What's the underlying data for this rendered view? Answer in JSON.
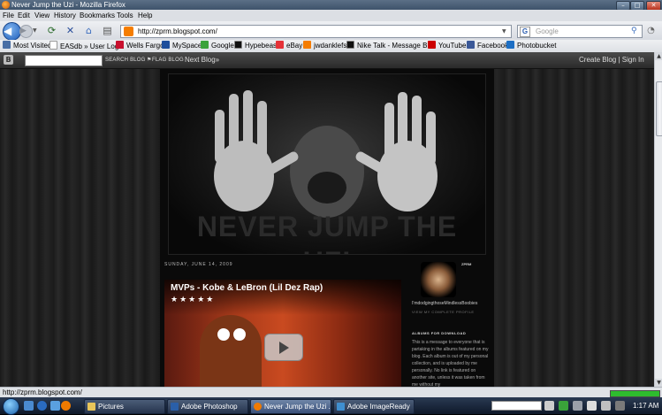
{
  "window": {
    "title": "Never Jump the Uzi - Mozilla Firefox",
    "min": "–",
    "max": "□",
    "close": "✕"
  },
  "menu": [
    "File",
    "Edit",
    "View",
    "History",
    "Bookmarks",
    "Tools",
    "Help"
  ],
  "nav": {
    "url": "http://zprm.blogspot.com/",
    "search_placeholder": "Google"
  },
  "bookmarks": [
    {
      "label": "Most Visited",
      "color": "#4a6fa5"
    },
    {
      "label": "EASdb » User Login",
      "color": "#ffffff"
    },
    {
      "label": "Wells Fargo",
      "color": "#c8102e"
    },
    {
      "label": "MySpace",
      "color": "#1d4e9c"
    },
    {
      "label": "Google",
      "color": "#3aa33a"
    },
    {
      "label": "Hypebeast",
      "color": "#111111"
    },
    {
      "label": "eBay",
      "color": "#e53238"
    },
    {
      "label": "jwdanklefs",
      "color": "#f57d00"
    },
    {
      "label": "Nike Talk - Message B...",
      "color": "#111111"
    },
    {
      "label": "YouTube",
      "color": "#cc0000"
    },
    {
      "label": "Facebook",
      "color": "#3b5998"
    },
    {
      "label": "Photobucket",
      "color": "#1d6fc4"
    }
  ],
  "blogger": {
    "search_btn": "SEARCH BLOG",
    "flag_btn": "FLAG BLOG",
    "next": "Next Blog»",
    "create": "Create Blog | Sign In"
  },
  "blog": {
    "header_title": "NEVER JUMP THE UZI",
    "date": "SUNDAY, JUNE 14, 2009",
    "video_title": "MVPs - Kobe & LeBron (Lil Dez Rap)",
    "video_stars": "★★★★★",
    "profile_label": "ZPRM",
    "profile_name": "I'mdodgingthoseMindlessBoobies",
    "view_profile": "VIEW MY COMPLETE PROFILE",
    "albums_heading": "ALBUMS FOR DOWNLOAD",
    "albums_text": "This is a message to everyone that is partaking in the albums featured on my blog. Each album is out of my personal collection, and is uploaded by me personally. No link is featured on another site, unless it was taken from me without my"
  },
  "status": {
    "text": "http://zprm.blogspot.com/",
    "progress": 1.0
  },
  "taskbar": {
    "tasks": [
      {
        "label": "Pictures",
        "color": "#e8c55a"
      },
      {
        "label": "Adobe Photoshop",
        "color": "#2a5fa8"
      },
      {
        "label": "Never Jump the Uzi ...",
        "color": "#f07a00"
      },
      {
        "label": "Adobe ImageReady",
        "color": "#3f8fd0"
      }
    ],
    "clock": "1:17 AM"
  }
}
